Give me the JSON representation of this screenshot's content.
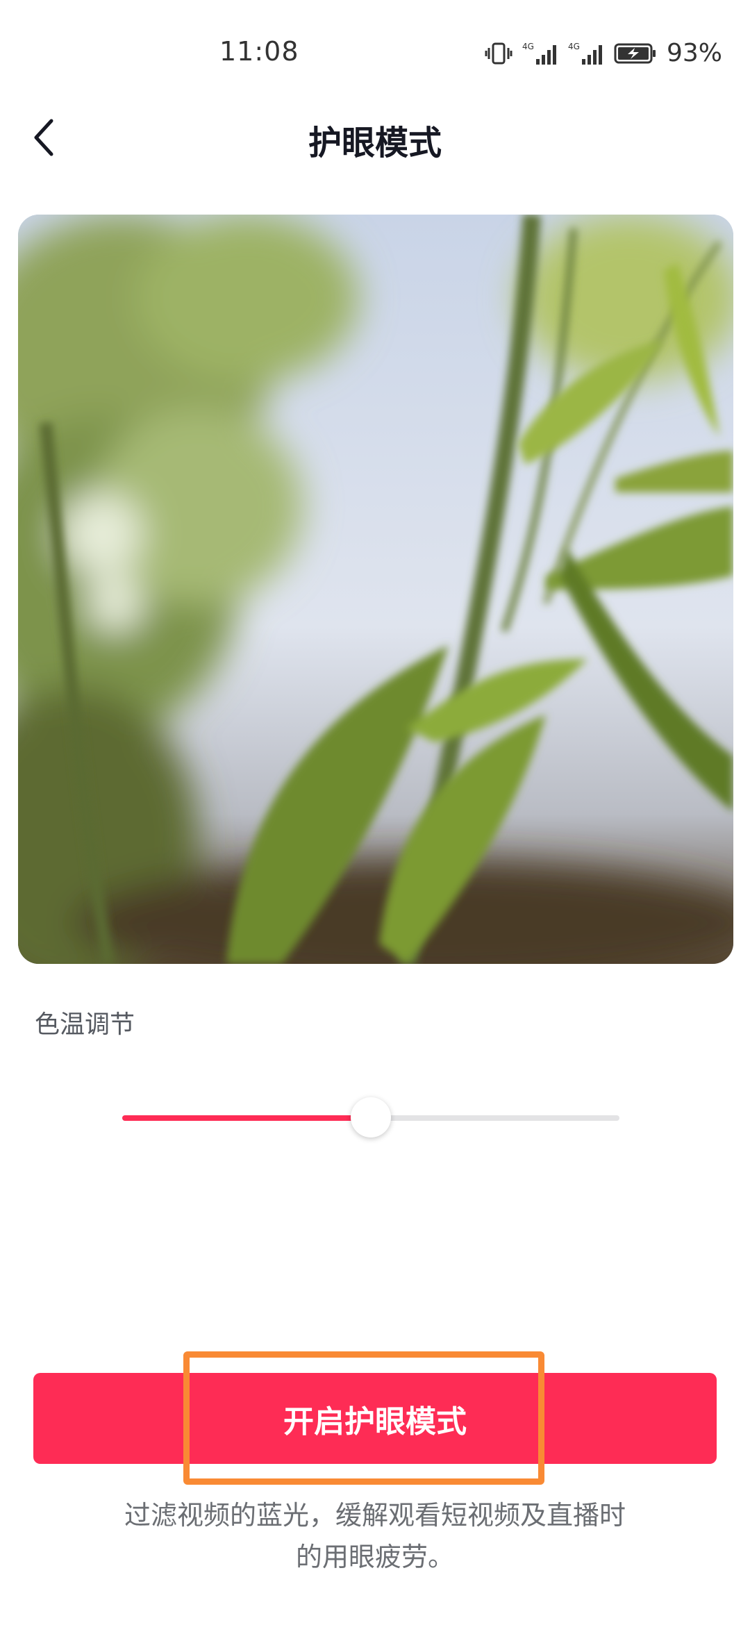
{
  "status_bar": {
    "time": "11:08",
    "battery_percent": "93%",
    "network_1": "4G",
    "network_2": "4G"
  },
  "header": {
    "title": "护眼模式"
  },
  "settings": {
    "color_temp_label": "色温调节",
    "color_temp_value": 0.5
  },
  "actions": {
    "enable_label": "开启护眼模式"
  },
  "description": {
    "line1": "过滤视频的蓝光，缓解观看短视频及直播时",
    "line2": "的用眼疲劳。"
  },
  "colors": {
    "accent": "#fe2c55",
    "highlight": "#f98a34"
  }
}
